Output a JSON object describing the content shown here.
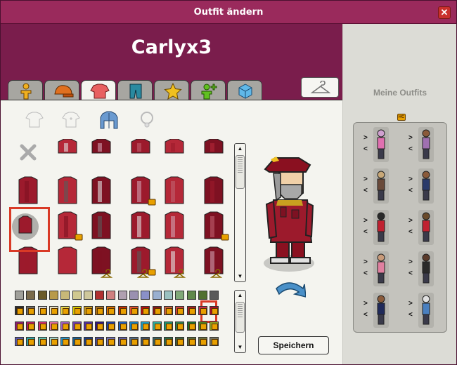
{
  "window": {
    "title": "Outfit ändern",
    "close_label": "✕"
  },
  "header": {
    "username": "Carlyx3"
  },
  "tabs": [
    {
      "name": "tab-body",
      "icon": "body-icon",
      "active": false
    },
    {
      "name": "tab-hats",
      "icon": "hat-icon",
      "active": false
    },
    {
      "name": "tab-tops",
      "icon": "shirt-icon",
      "active": true
    },
    {
      "name": "tab-trousers",
      "icon": "trousers-icon",
      "active": false
    },
    {
      "name": "tab-accessories",
      "icon": "star-icon",
      "active": false
    },
    {
      "name": "tab-effects",
      "icon": "figure-plus-icon",
      "active": false
    },
    {
      "name": "tab-club",
      "icon": "cube-icon",
      "active": false
    }
  ],
  "sub_categories": [
    "tshirt-icon",
    "chest-print-icon",
    "jacket-icon",
    "necklace-icon"
  ],
  "right_panel": {
    "title": "Meine Outfits",
    "badge": "HC"
  },
  "actions": {
    "save_label": "Speichern"
  },
  "colors": {
    "accent": "#7a1d4c",
    "title_bar": "#9a2a5c",
    "selection": "#d93a26",
    "item_red": "#9c1a2c"
  },
  "swatch_rows": [
    {
      "hc": false,
      "colors": [
        "#a0a09a",
        "#7a6a4a",
        "#6a5a2a",
        "#b89a4a",
        "#c8b878",
        "#d0c890",
        "#cfc79c",
        "#b03030",
        "#d08080",
        "#b0a0b0",
        "#9a90b0",
        "#8a90c8",
        "#9ab0d0",
        "#9ac0c0",
        "#80a878",
        "#60884a",
        "#507030",
        "#5a5a5a"
      ]
    },
    {
      "hc": true,
      "colors": [
        "#2a2a2a",
        "#6a6a6a",
        "#d8d8d8",
        "#e8e0c0",
        "#e8d850",
        "#d8c800",
        "#c89a20",
        "#a87020",
        "#d87000",
        "#c83000",
        "#e05030",
        "#b81010",
        "#8a1818",
        "#c86040",
        "#d04040",
        "#a82020",
        "#c83050",
        "#a8102a"
      ]
    },
    {
      "hc": true,
      "colors": [
        "#8a2070",
        "#b02060",
        "#d03070",
        "#e070a0",
        "#a060c0",
        "#7040b0",
        "#5030a0",
        "#301880",
        "#2040a0",
        "#2060c0",
        "#1880c0",
        "#20a0c8",
        "#30b0a0",
        "#209070",
        "#308050",
        "#207030",
        "#508020",
        "#90a020"
      ]
    },
    {
      "hc": true,
      "colors": [
        "#5858a8",
        "#30a0a0",
        "#60c0b0",
        "#a0d0c8",
        "#2a90c0",
        "#1a6090",
        "#204080",
        "#4a4a90",
        "#7070b0",
        "#6060a0",
        "#506880",
        "#405060",
        "#386060",
        "#306848",
        "#406040",
        "#5a6a3a",
        "#6a7040",
        "#707060"
      ]
    }
  ],
  "item_colors": [
    "#9c1a2c",
    "#b52838",
    "#7e1122",
    "#5a5a5a",
    "#e0e0e0",
    "#d0a0b0",
    "#c06070"
  ]
}
